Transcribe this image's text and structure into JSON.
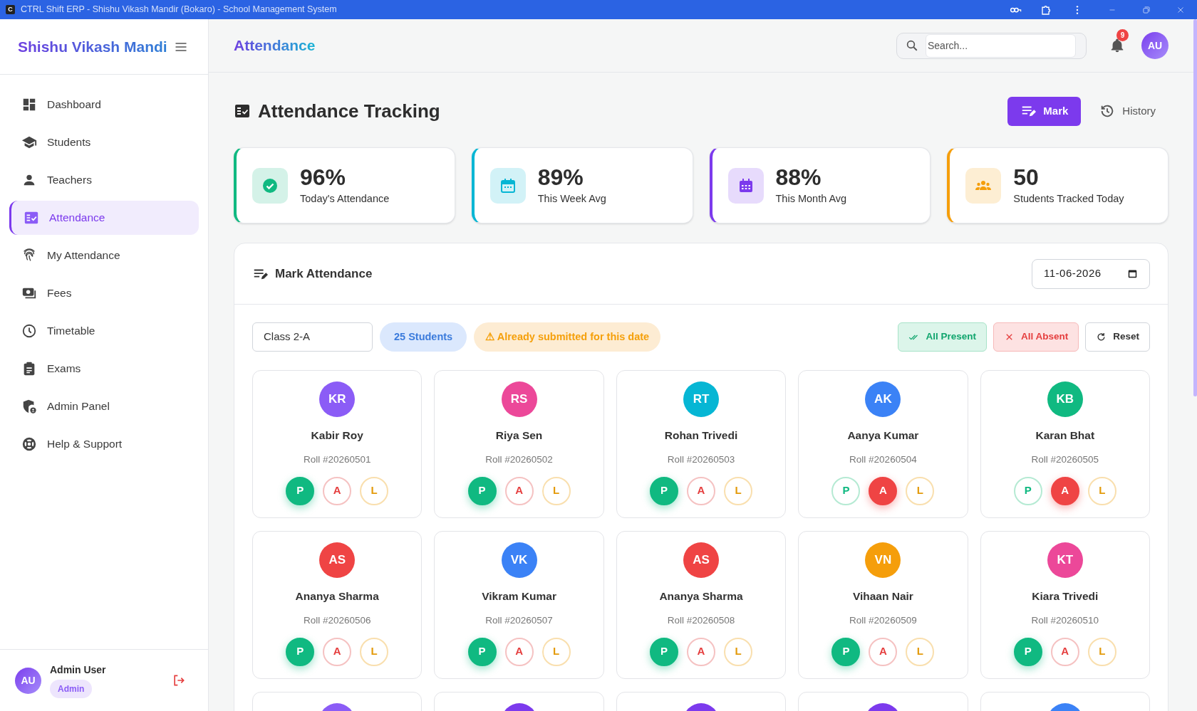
{
  "window": {
    "app_letter": "C",
    "title": "CTRL Shift ERP - Shishu Vikash Mandir (Bokaro) - School Management System"
  },
  "sidebar": {
    "brand": "Shishu Vikash Mandi",
    "items": [
      {
        "label": "Dashboard",
        "selected": false
      },
      {
        "label": "Students",
        "selected": false
      },
      {
        "label": "Teachers",
        "selected": false
      },
      {
        "label": "Attendance",
        "selected": true
      },
      {
        "label": "My Attendance",
        "selected": false
      },
      {
        "label": "Fees",
        "selected": false
      },
      {
        "label": "Timetable",
        "selected": false
      },
      {
        "label": "Exams",
        "selected": false
      },
      {
        "label": "Admin Panel",
        "selected": false
      },
      {
        "label": "Help & Support",
        "selected": false
      }
    ],
    "user": {
      "initials": "AU",
      "name": "Admin User",
      "role": "Admin"
    }
  },
  "header": {
    "title": "Attendance",
    "search": {
      "placeholder": "Search..."
    },
    "notifications": "9",
    "avatar": "AU"
  },
  "page": {
    "title": "Attendance Tracking",
    "buttons": [
      {
        "label": "Mark",
        "selected": true
      },
      {
        "label": "History",
        "selected": false
      }
    ]
  },
  "stats": [
    {
      "value": "96%",
      "label": "Today's Attendance",
      "color": "#10b981"
    },
    {
      "value": "89%",
      "label": "This Week Avg",
      "color": "#06b6d4"
    },
    {
      "value": "88%",
      "label": "This Month Avg",
      "color": "#7c3aed"
    },
    {
      "value": "50",
      "label": "Students Tracked Today",
      "color": "#f59e0b"
    }
  ],
  "panel": {
    "title": "Mark Attendance",
    "date": "11-06-2026",
    "class": "Class 2-A",
    "count": "25 Students",
    "warning": "⚠ Already submitted for this date",
    "actions": [
      {
        "kind": "present",
        "label": "All Present"
      },
      {
        "kind": "absent",
        "label": "All Absent"
      },
      {
        "kind": "reset",
        "label": "Reset"
      }
    ],
    "students": [
      {
        "initials": "KR",
        "name": "Kabir Roy",
        "roll": "Roll #20260501",
        "color": "#8b5cf6",
        "marks": [
          {
            "kind": "present",
            "label": "P",
            "selected": true
          },
          {
            "kind": "absent",
            "label": "A",
            "selected": false
          },
          {
            "kind": "late",
            "label": "L",
            "selected": false
          }
        ]
      },
      {
        "initials": "RS",
        "name": "Riya Sen",
        "roll": "Roll #20260502",
        "color": "#ec4899",
        "marks": [
          {
            "kind": "present",
            "label": "P",
            "selected": true
          },
          {
            "kind": "absent",
            "label": "A",
            "selected": false
          },
          {
            "kind": "late",
            "label": "L",
            "selected": false
          }
        ]
      },
      {
        "initials": "RT",
        "name": "Rohan Trivedi",
        "roll": "Roll #20260503",
        "color": "#06b6d4",
        "marks": [
          {
            "kind": "present",
            "label": "P",
            "selected": true
          },
          {
            "kind": "absent",
            "label": "A",
            "selected": false
          },
          {
            "kind": "late",
            "label": "L",
            "selected": false
          }
        ]
      },
      {
        "initials": "AK",
        "name": "Aanya Kumar",
        "roll": "Roll #20260504",
        "color": "#3b82f6",
        "marks": [
          {
            "kind": "present",
            "label": "P",
            "selected": false
          },
          {
            "kind": "absent",
            "label": "A",
            "selected": true
          },
          {
            "kind": "late",
            "label": "L",
            "selected": false
          }
        ]
      },
      {
        "initials": "KB",
        "name": "Karan Bhat",
        "roll": "Roll #20260505",
        "color": "#10b981",
        "marks": [
          {
            "kind": "present",
            "label": "P",
            "selected": false
          },
          {
            "kind": "absent",
            "label": "A",
            "selected": true
          },
          {
            "kind": "late",
            "label": "L",
            "selected": false
          }
        ]
      },
      {
        "initials": "AS",
        "name": "Ananya Sharma",
        "roll": "Roll #20260506",
        "color": "#ef4444",
        "marks": [
          {
            "kind": "present",
            "label": "P",
            "selected": true
          },
          {
            "kind": "absent",
            "label": "A",
            "selected": false
          },
          {
            "kind": "late",
            "label": "L",
            "selected": false
          }
        ]
      },
      {
        "initials": "VK",
        "name": "Vikram Kumar",
        "roll": "Roll #20260507",
        "color": "#3b82f6",
        "marks": [
          {
            "kind": "present",
            "label": "P",
            "selected": true
          },
          {
            "kind": "absent",
            "label": "A",
            "selected": false
          },
          {
            "kind": "late",
            "label": "L",
            "selected": false
          }
        ]
      },
      {
        "initials": "AS",
        "name": "Ananya Sharma",
        "roll": "Roll #20260508",
        "color": "#ef4444",
        "marks": [
          {
            "kind": "present",
            "label": "P",
            "selected": true
          },
          {
            "kind": "absent",
            "label": "A",
            "selected": false
          },
          {
            "kind": "late",
            "label": "L",
            "selected": false
          }
        ]
      },
      {
        "initials": "VN",
        "name": "Vihaan Nair",
        "roll": "Roll #20260509",
        "color": "#f59e0b",
        "marks": [
          {
            "kind": "present",
            "label": "P",
            "selected": true
          },
          {
            "kind": "absent",
            "label": "A",
            "selected": false
          },
          {
            "kind": "late",
            "label": "L",
            "selected": false
          }
        ]
      },
      {
        "initials": "KT",
        "name": "Kiara Trivedi",
        "roll": "Roll #20260510",
        "color": "#ec4899",
        "marks": [
          {
            "kind": "present",
            "label": "P",
            "selected": true
          },
          {
            "kind": "absent",
            "label": "A",
            "selected": false
          },
          {
            "kind": "late",
            "label": "L",
            "selected": false
          }
        ]
      },
      {
        "color": "#8b5cf6"
      },
      {
        "color": "#7c3aed"
      },
      {
        "color": "#7c3aed"
      },
      {
        "color": "#7c3aed"
      },
      {
        "color": "#3b82f6"
      }
    ]
  }
}
